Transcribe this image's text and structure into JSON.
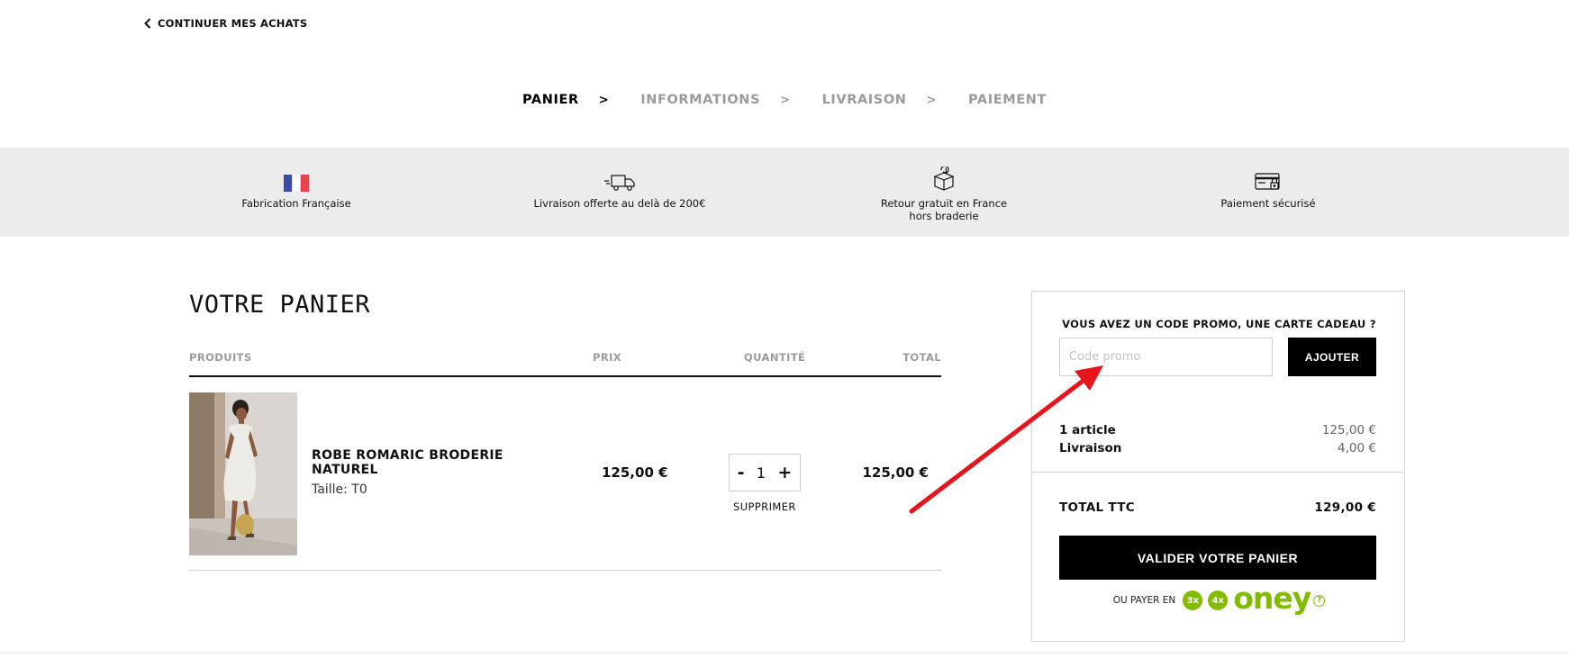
{
  "back_link": {
    "label": "CONTINUER MES ACHATS"
  },
  "steps": [
    {
      "label": "PANIER",
      "active": true
    },
    {
      "label": "INFORMATIONS",
      "active": false
    },
    {
      "label": "LIVRAISON",
      "active": false
    },
    {
      "label": "PAIEMENT",
      "active": false
    }
  ],
  "step_separator": ">",
  "features": [
    {
      "icon": "french-flag-icon",
      "text": "Fabrication Française"
    },
    {
      "icon": "delivery-truck-icon",
      "text": "Livraison offerte au delà de 200€"
    },
    {
      "icon": "return-box-icon",
      "text": "Retour gratuit en France",
      "text2": "hors braderie"
    },
    {
      "icon": "secure-card-icon",
      "text": "Paiement sécurisé"
    }
  ],
  "cart": {
    "title": "VOTRE PANIER",
    "columns": {
      "products": "PRODUITS",
      "price": "PRIX",
      "quantity": "QUANTITÉ",
      "total": "TOTAL"
    },
    "items": [
      {
        "name": "ROBE ROMARIC BRODERIE NATUREL",
        "size": "Taille: T0",
        "price": "125,00 €",
        "quantity": "1",
        "total": "125,00 €",
        "remove_label": "SUPPRIMER",
        "minus": "-",
        "plus": "+"
      }
    ]
  },
  "summary": {
    "promo_title": "VOUS AVEZ UN CODE PROMO, UNE CARTE CADEAU ?",
    "promo_placeholder": "Code promo",
    "add_label": "AJOUTER",
    "articles_label": "1 article",
    "articles_value": "125,00 €",
    "shipping_label": "Livraison",
    "shipping_value": "4,00 €",
    "total_label": "TOTAL TTC",
    "total_value": "129,00 €",
    "validate_label": "VALIDER VOTRE PANIER",
    "pay_in_label": "OU PAYER EN",
    "oney_3x": "3x",
    "oney_4x": "4x",
    "oney_brand": "oney",
    "oney_help": "?"
  },
  "colors": {
    "accent": "#000000",
    "band": "#ececec",
    "oney_green": "#81bc00",
    "annotation_arrow": "#e8141b"
  }
}
